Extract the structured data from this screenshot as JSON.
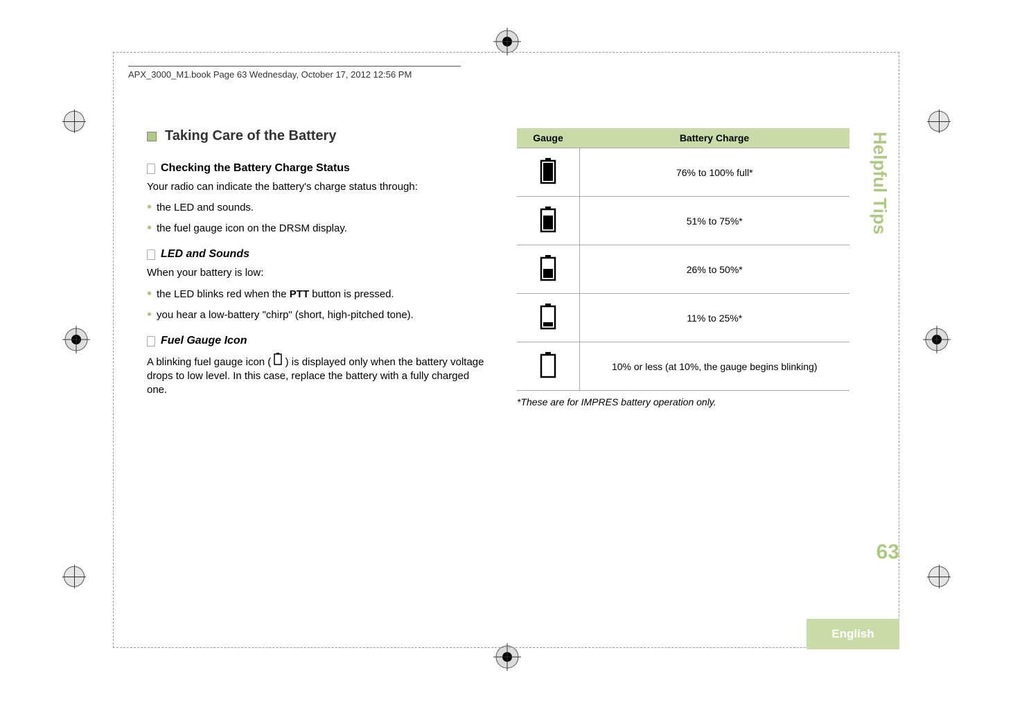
{
  "header": "APX_3000_M1.book  Page 63  Wednesday, October 17, 2012  12:56 PM",
  "section_title": "Taking Care of the Battery",
  "sub1_title": "Checking the Battery Charge Status",
  "sub1_body": "Your radio can indicate the battery's charge status through:",
  "sub1_bullets": [
    "the LED and sounds.",
    "the fuel gauge icon on the DRSM display."
  ],
  "sub2_title": "LED and Sounds",
  "sub2_body": "When your battery is low:",
  "sub2_bullets_a": "the LED blinks red when the ",
  "sub2_bullets_a_bold": "PTT",
  "sub2_bullets_a_after": " button is pressed.",
  "sub2_bullets_b": "you hear a low-battery \"chirp\" (short, high-pitched tone).",
  "sub3_title": "Fuel Gauge Icon",
  "sub3_body_a": "A blinking fuel gauge icon ( ",
  "sub3_body_b": " ) is displayed only when the battery voltage drops to low level. In this case, replace the battery with a fully charged one.",
  "table": {
    "col1": "Gauge",
    "col2": "Battery Charge",
    "rows": [
      {
        "icon": "batt-100",
        "text": "76% to 100% full*"
      },
      {
        "icon": "batt-75",
        "text": "51% to 75%*"
      },
      {
        "icon": "batt-50",
        "text": "26% to 50%*"
      },
      {
        "icon": "batt-25",
        "text": "11% to 25%*"
      },
      {
        "icon": "batt-0",
        "text": "10% or less (at 10%, the gauge begins blinking)"
      }
    ]
  },
  "footnote": "*These are for IMPRES battery operation only.",
  "tab_label": "Helpful Tips",
  "page_number": "63",
  "language": "English"
}
